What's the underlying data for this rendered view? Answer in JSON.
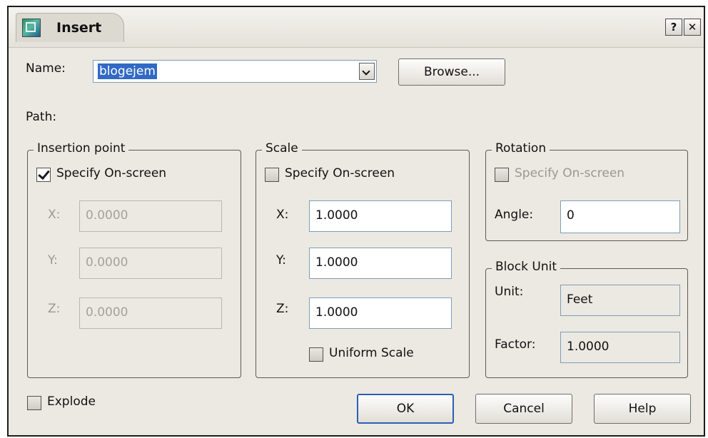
{
  "window": {
    "title": "Insert",
    "help_glyph": "?",
    "close_glyph": "✕"
  },
  "name": {
    "label": "Name:",
    "value": "blogejem",
    "browse_label": "Browse..."
  },
  "path": {
    "label": "Path:"
  },
  "insertion_point": {
    "legend": "Insertion point",
    "specify_label": "Specify On-screen",
    "specify_checked": true,
    "x_label": "X:",
    "x_value": "0.0000",
    "y_label": "Y:",
    "y_value": "0.0000",
    "z_label": "Z:",
    "z_value": "0.0000"
  },
  "scale": {
    "legend": "Scale",
    "specify_label": "Specify On-screen",
    "specify_checked": false,
    "x_label": "X:",
    "x_value": "1.0000",
    "y_label": "Y:",
    "y_value": "1.0000",
    "z_label": "Z:",
    "z_value": "1.0000",
    "uniform_label": "Uniform Scale",
    "uniform_checked": false
  },
  "rotation": {
    "legend": "Rotation",
    "specify_label": "Specify On-screen",
    "specify_checked": false,
    "angle_label": "Angle:",
    "angle_value": "0"
  },
  "block_unit": {
    "legend": "Block Unit",
    "unit_label": "Unit:",
    "unit_value": "Feet",
    "factor_label": "Factor:",
    "factor_value": "1.0000"
  },
  "explode": {
    "label": "Explode",
    "checked": false
  },
  "buttons": {
    "ok": "OK",
    "cancel": "Cancel",
    "help": "Help"
  }
}
